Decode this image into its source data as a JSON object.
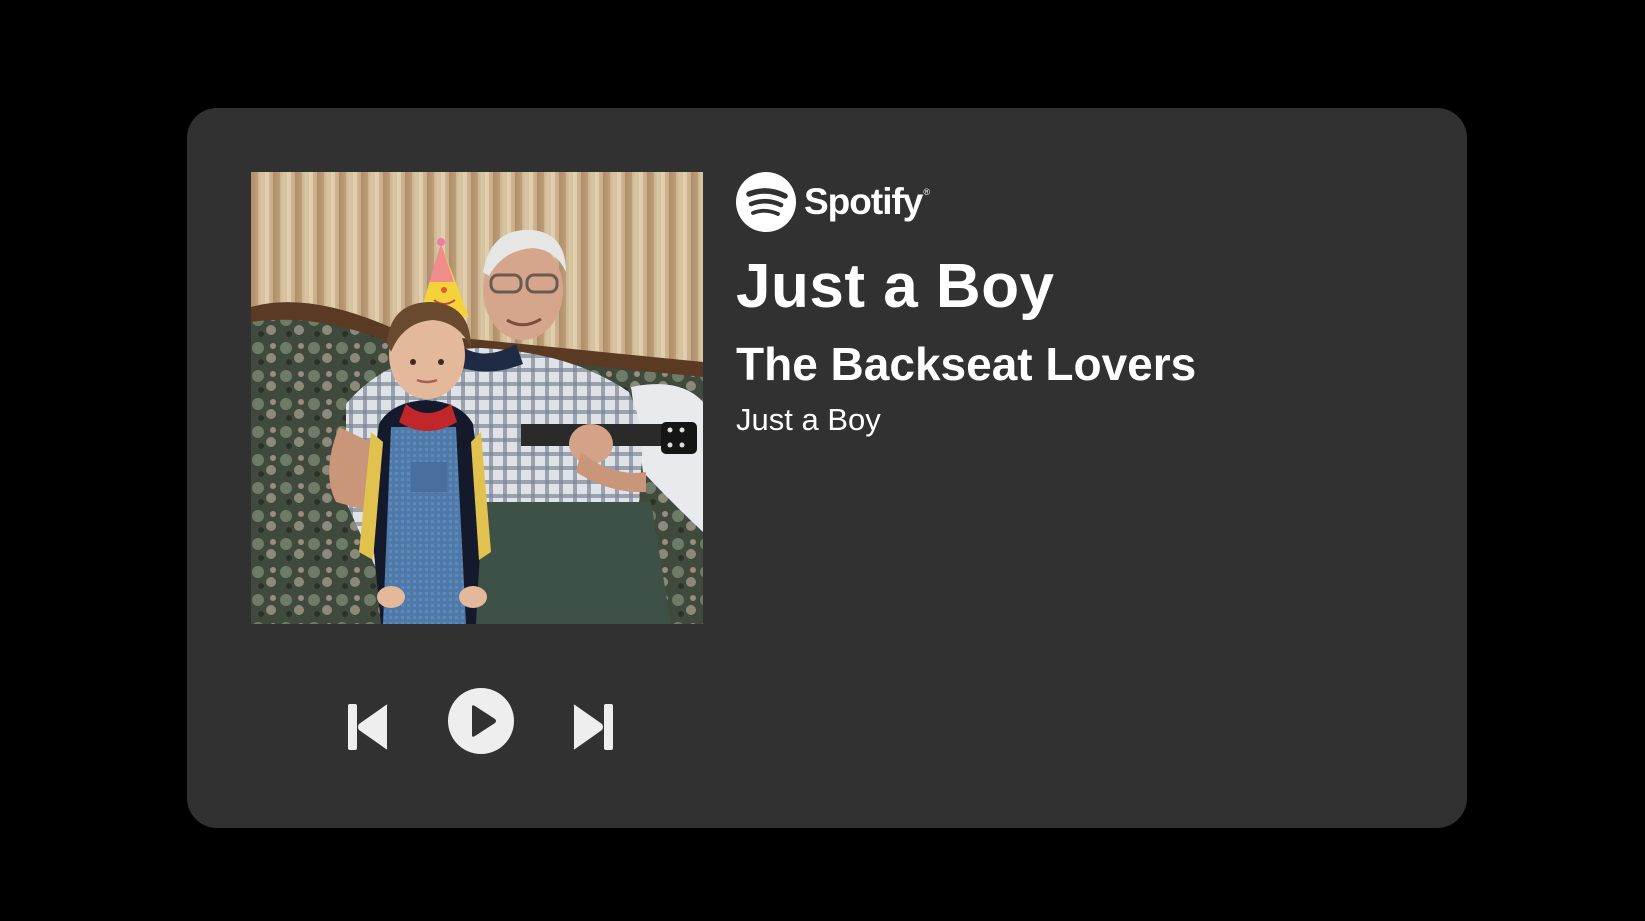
{
  "brand": {
    "name": "Spotify",
    "registered_mark": "®",
    "logo_icon": "spotify-logo-icon"
  },
  "track": {
    "title": "Just a Boy",
    "artist": "The Backseat Lovers",
    "album": "Just a Boy"
  },
  "controls": {
    "previous_icon": "skip-previous-icon",
    "play_icon": "play-icon",
    "next_icon": "skip-next-icon"
  },
  "colors": {
    "page_background": "#000000",
    "card_background": "#313131",
    "text": "#ffffff",
    "control_icon": "#eeeeee"
  }
}
